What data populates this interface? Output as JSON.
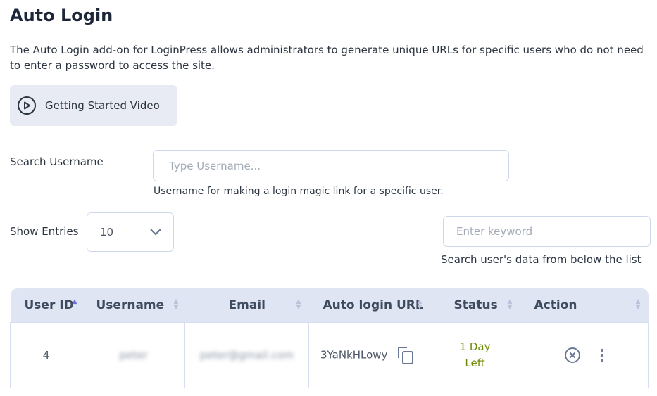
{
  "page": {
    "title": "Auto Login",
    "description": "The Auto Login add-on for LoginPress allows administrators to generate unique URLs for specific users who do not need to enter a password to access the site."
  },
  "video_button": {
    "label": "Getting Started Video",
    "icon": "play-circle-icon"
  },
  "search_username": {
    "label": "Search Username",
    "placeholder": "Type Username...",
    "help": "Username for making a login magic link for a specific user."
  },
  "entries": {
    "label": "Show Entries",
    "value": "10"
  },
  "keyword": {
    "placeholder": "Enter keyword",
    "help": "Search user's data from below the list"
  },
  "table": {
    "columns": [
      "User ID",
      "Username",
      "Email",
      "Auto login URL",
      "Status",
      "Action"
    ],
    "rows": [
      {
        "user_id": "4",
        "username": "peter",
        "email": "peter@gmail.com",
        "url": "3YaNkHLowy",
        "status_line1": "1 Day",
        "status_line2": "Left"
      }
    ]
  },
  "colors": {
    "header_bg": "#dfe5f2",
    "status": "#6b8a00",
    "sort_active": "#6c72d8"
  }
}
